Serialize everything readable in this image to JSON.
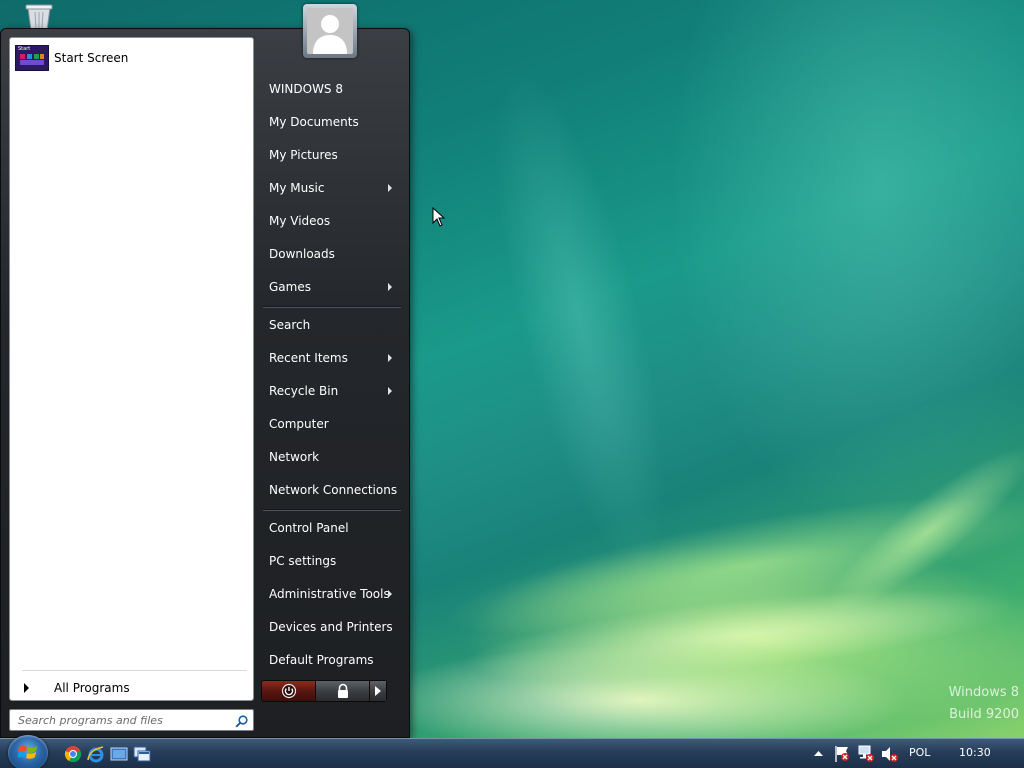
{
  "start_menu": {
    "pinned": [
      {
        "label": "Start Screen",
        "tile_text": "Start",
        "icon": "start-screen-tile-icon"
      }
    ],
    "all_programs_label": "All Programs",
    "search_placeholder": "Search programs and files",
    "user_picture_icon": "user-avatar-icon",
    "right_items": [
      {
        "label": "WINDOWS 8",
        "submenu": false
      },
      {
        "label": "My Documents",
        "submenu": false
      },
      {
        "label": "My Pictures",
        "submenu": false
      },
      {
        "label": "My Music",
        "submenu": true
      },
      {
        "label": "My Videos",
        "submenu": false
      },
      {
        "label": "Downloads",
        "submenu": false
      },
      {
        "label": "Games",
        "submenu": true
      },
      {
        "label": "Search",
        "submenu": false
      },
      {
        "label": "Recent Items",
        "submenu": true
      },
      {
        "label": "Recycle Bin",
        "submenu": true
      },
      {
        "label": "Computer",
        "submenu": false
      },
      {
        "label": "Network",
        "submenu": false
      },
      {
        "label": "Network Connections",
        "submenu": false
      },
      {
        "label": "Control Panel",
        "submenu": false
      },
      {
        "label": "PC settings",
        "submenu": false
      },
      {
        "label": "Administrative Tools",
        "submenu": true
      },
      {
        "label": "Devices and Printers",
        "submenu": false
      },
      {
        "label": "Default Programs",
        "submenu": false
      }
    ],
    "power_icons": [
      "power-icon",
      "lock-icon",
      "chevron-right-icon"
    ]
  },
  "desktop": {
    "icons": [
      "recycle-bin-icon"
    ],
    "watermark": {
      "line1": "Windows 8",
      "line2": "Build 9200"
    }
  },
  "taskbar": {
    "start_orb_icon": "windows-orb-icon",
    "quick_launch_icons": [
      "chrome-icon",
      "internet-explorer-icon",
      "show-desktop-icon",
      "switch-windows-icon"
    ],
    "tray": {
      "icons": [
        "show-hidden-icons-icon",
        "action-center-icon",
        "network-icon",
        "volume-muted-icon"
      ],
      "language": "POL",
      "time": "10:30"
    }
  },
  "colors": {
    "menu_bg": "#24272b",
    "menu_text": "#ffffff",
    "taskbar_bg": "#263d59",
    "power_button": "#7a2418"
  }
}
